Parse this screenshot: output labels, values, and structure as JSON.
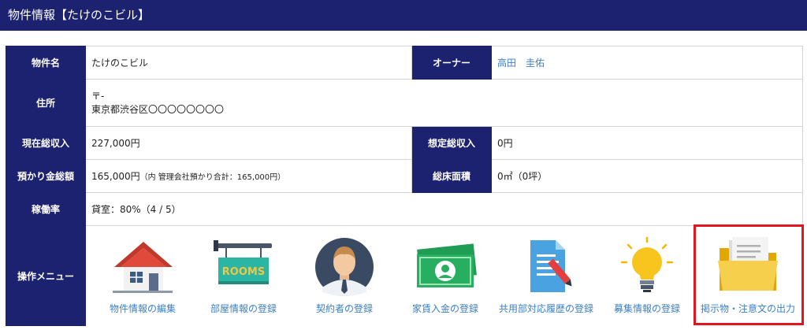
{
  "header": {
    "title": "物件情報【たけのこビル】"
  },
  "rows": {
    "name": {
      "label": "物件名",
      "value": "たけのこビル"
    },
    "owner": {
      "label": "オーナー",
      "value": "高田　圭佑"
    },
    "address": {
      "label": "住所",
      "postal": "〒-",
      "value": "東京都渋谷区〇〇〇〇〇〇〇〇"
    },
    "income": {
      "label": "現在総収入",
      "value": "227,000円"
    },
    "expected": {
      "label": "想定総収入",
      "value": "0円"
    },
    "deposit": {
      "label": "預かり金総額",
      "value": "165,000円",
      "note": "（内 管理会社預かり合計：165,000円）"
    },
    "floor": {
      "label": "総床面積",
      "value": "0㎡（0坪）"
    },
    "occupancy": {
      "label": "稼働率",
      "value": "貸室：80%（4 / 5）"
    },
    "menu_label": "操作メニュー"
  },
  "menu": [
    {
      "label": "物件情報の編集",
      "icon": "house-icon"
    },
    {
      "label": "部屋情報の登録",
      "icon": "rooms-sign-icon"
    },
    {
      "label": "契約者の登録",
      "icon": "person-icon"
    },
    {
      "label": "家賃入金の登録",
      "icon": "banknote-icon"
    },
    {
      "label": "共用部対応履歴の登録",
      "icon": "document-pen-icon"
    },
    {
      "label": "募集情報の登録",
      "icon": "lightbulb-icon"
    },
    {
      "label": "掲示物・注意文の出力",
      "icon": "folder-icon"
    }
  ],
  "rooms_sign_text": "ROOMS",
  "colors": {
    "header": "#1c2170",
    "link": "#3b7fc4",
    "highlight": "#e3141e"
  }
}
